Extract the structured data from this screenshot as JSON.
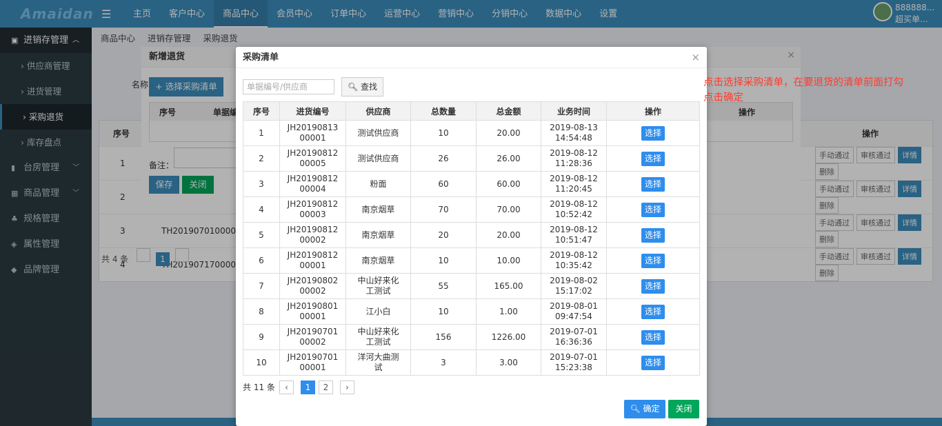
{
  "app": {
    "logo": "Amaidan",
    "menu_icon": "menu-icon"
  },
  "topnav": [
    "主页",
    "客户中心",
    "商品中心",
    "会员中心",
    "订单中心",
    "运营中心",
    "营销中心",
    "分销中心",
    "数据中心",
    "设置"
  ],
  "user": {
    "avatar_text": "头像",
    "line1": "888888...",
    "line2": "超买单..."
  },
  "sidebar": {
    "group1": "进销存管理",
    "items": [
      "供应商管理",
      "进货管理",
      "采购退货",
      "库存盘点"
    ],
    "groups": [
      "台房管理",
      "商品管理",
      "规格管理",
      "属性管理",
      "品牌管理"
    ]
  },
  "breadcrumb": [
    "商品中心",
    "进销存管理",
    "采购退货"
  ],
  "bg_table": {
    "headers": [
      "序号",
      "操作"
    ],
    "rows": [
      {
        "index": "1",
        "code": ""
      },
      {
        "index": "2",
        "code": ""
      },
      {
        "index": "3",
        "code": "TH2019070100001"
      },
      {
        "index": "4",
        "code": "TH2019071700002"
      }
    ],
    "actions": [
      "手动通过",
      "审核通过",
      "详情",
      "删除"
    ],
    "pager": {
      "total": "共 4 条",
      "page": "1"
    }
  },
  "dialog1": {
    "title": "新增退货",
    "name_label": "名称",
    "choose_button": "+ 选择采购清单",
    "table_headers": [
      "序号",
      "单据编",
      "操作"
    ],
    "remark_label": "备注：",
    "save_button": "保存",
    "close_button": "关闭"
  },
  "dialog": {
    "title": "采购清单",
    "search_placeholder": "单据编号/供应商",
    "search_button": "查找",
    "headers": [
      "序号",
      "进货编号",
      "供应商",
      "总数量",
      "总金额",
      "业务时间",
      "操作"
    ],
    "rows": [
      {
        "idx": "1",
        "code1": "JH20190813",
        "code2": "00001",
        "sup1": "测试供应商",
        "sup2": "",
        "qty": "10",
        "amt": "20.00",
        "date": "2019-08-13",
        "time": "14:54:48"
      },
      {
        "idx": "2",
        "code1": "JH20190812",
        "code2": "00005",
        "sup1": "测试供应商",
        "sup2": "",
        "qty": "26",
        "amt": "26.00",
        "date": "2019-08-12",
        "time": "11:28:36"
      },
      {
        "idx": "3",
        "code1": "JH20190812",
        "code2": "00004",
        "sup1": "粉面",
        "sup2": "",
        "qty": "60",
        "amt": "60.00",
        "date": "2019-08-12",
        "time": "11:20:45"
      },
      {
        "idx": "4",
        "code1": "JH20190812",
        "code2": "00003",
        "sup1": "南京烟草",
        "sup2": "",
        "qty": "70",
        "amt": "70.00",
        "date": "2019-08-12",
        "time": "10:52:42"
      },
      {
        "idx": "5",
        "code1": "JH20190812",
        "code2": "00002",
        "sup1": "南京烟草",
        "sup2": "",
        "qty": "20",
        "amt": "20.00",
        "date": "2019-08-12",
        "time": "10:51:47"
      },
      {
        "idx": "6",
        "code1": "JH20190812",
        "code2": "00001",
        "sup1": "南京烟草",
        "sup2": "",
        "qty": "10",
        "amt": "10.00",
        "date": "2019-08-12",
        "time": "10:35:42"
      },
      {
        "idx": "7",
        "code1": "JH20190802",
        "code2": "00002",
        "sup1": "中山好来化",
        "sup2": "工测试",
        "qty": "55",
        "amt": "165.00",
        "date": "2019-08-02",
        "time": "15:17:02"
      },
      {
        "idx": "8",
        "code1": "JH20190801",
        "code2": "00001",
        "sup1": "江小白",
        "sup2": "",
        "qty": "10",
        "amt": "1.00",
        "date": "2019-08-01",
        "time": "09:47:54"
      },
      {
        "idx": "9",
        "code1": "JH20190701",
        "code2": "00002",
        "sup1": "中山好来化",
        "sup2": "工测试",
        "qty": "156",
        "amt": "1226.00",
        "date": "2019-07-01",
        "time": "16:36:36"
      },
      {
        "idx": "10",
        "code1": "JH20190701",
        "code2": "00001",
        "sup1": "洋河大曲测",
        "sup2": "试",
        "qty": "3",
        "amt": "3.00",
        "date": "2019-07-01",
        "time": "15:23:38"
      }
    ],
    "select_label": "选择",
    "pager": {
      "total": "共 11 条",
      "prev": "‹",
      "pages": [
        "1",
        "2"
      ],
      "next": "›"
    },
    "ok_button": "确定",
    "cancel_button": "关闭"
  },
  "annotation": {
    "line1": "点击选择采购清单，在要退货的清单前面打勾",
    "line2": "点击确定"
  },
  "colors": {
    "primary": "#2e8ded",
    "success": "#00a65a",
    "header": "#3c8dbc",
    "annotation": "#ff3b2f"
  }
}
